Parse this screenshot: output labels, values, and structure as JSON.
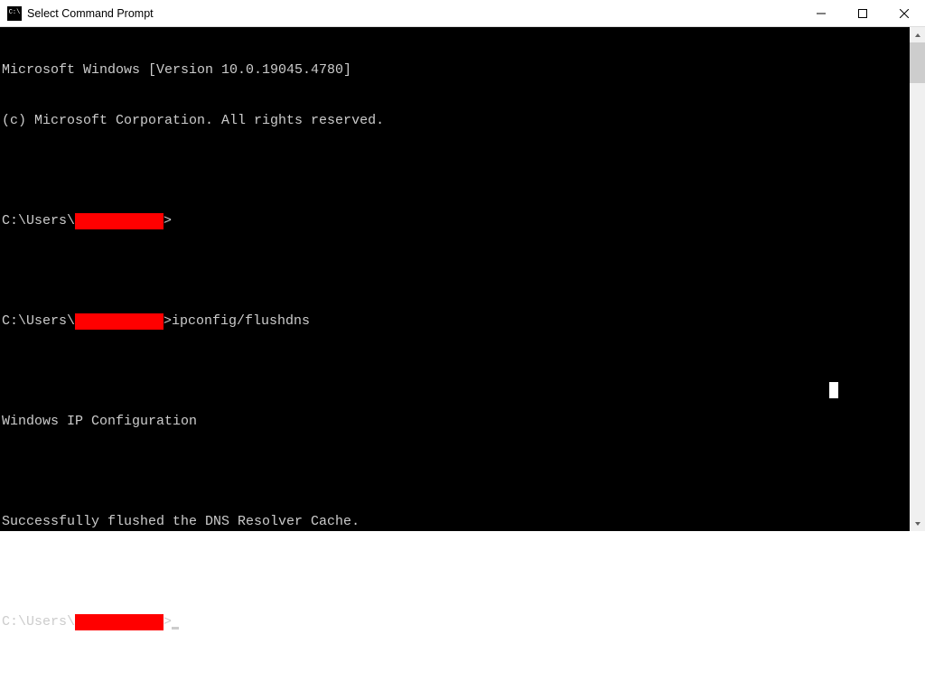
{
  "window": {
    "title": "Select Command Prompt"
  },
  "terminal": {
    "line1": "Microsoft Windows [Version 10.0.19045.4780]",
    "line2": "(c) Microsoft Corporation. All rights reserved.",
    "prompt_prefix": "C:\\Users\\",
    "prompt_suffix": ">",
    "command1": "ipconfig/flushdns",
    "output_header": "Windows IP Configuration",
    "output_msg": "Successfully flushed the DNS Resolver Cache."
  }
}
